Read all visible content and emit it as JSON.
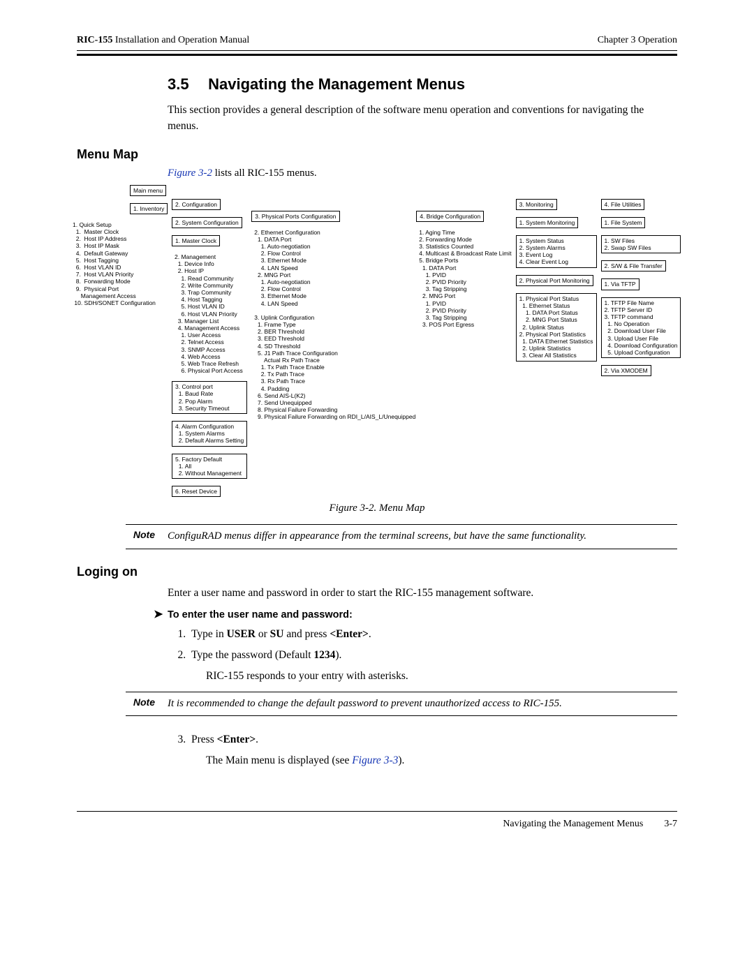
{
  "header": {
    "product": "RIC-155",
    "manual": "Installation and Operation Manual",
    "chapter": "Chapter 3  Operation"
  },
  "section": {
    "number": "3.5",
    "title": "Navigating the Management Menus",
    "intro": "This section provides a general description of the software menu operation and conventions for navigating the menus."
  },
  "menumap": {
    "heading": "Menu Map",
    "caption_ref": "Figure 3-2",
    "caption_rest": " lists all RIC-155 menus.",
    "figure_caption": "Figure 3-2.  Menu Map"
  },
  "tree": {
    "root": "Main menu",
    "inventory": {
      "label": "1. Inventory",
      "items": "1. Quick Setup\n  1.  Master Clock\n  2.  Host IP Address\n  3.  Host IP Mask\n  4.  Default Gateway\n  5.  Host Tagging\n  6.  Host VLAN ID\n  7.  Host VLAN Priority\n  8.  Forwarding Mode\n  9.  Physical Port\n     Management Access\n 10. SDH/SONET Configuration"
    },
    "configuration": {
      "label": "2. Configuration",
      "sysconf": "2. System Configuration",
      "masterclock": "1. Master Clock",
      "management": "2. Management\n  1. Device Info\n  2. Host IP\n    1. Read Community\n    2. Write Community\n    3. Trap Community\n    4. Host Tagging\n    5. Host VLAN ID\n    6. Host VLAN Priority\n  3. Manager List\n  4. Management Access\n    1. User Access\n    2. Telnet Access\n    3. SNMP Access\n    4. Web Access\n    5. Web Trace Refresh\n    6. Physical Port Access",
      "controlport": "3. Control port\n  1. Baud Rate\n  2. Pop Alarm\n  3. Security Timeout",
      "alarmconf": "4. Alarm Configuration\n  1. System Alarms\n  2. Default Alarms Setting",
      "factory": "5. Factory Default\n  1. All\n  2. Without Management",
      "reset": "6. Reset Device",
      "physports": "3. Physical Ports Configuration",
      "ethernet": "2. Ethernet Configuration\n  1. DATA Port\n    1. Auto-negotiation\n    2. Flow Control\n    3. Ethernet Mode\n    4. LAN Speed\n  2. MNG Port\n    1. Auto-negotiation\n    2. Flow Control\n    3. Ethernet Mode\n    4. LAN Speed",
      "uplink": "3. Uplink Configuration\n  1. Frame Type\n  2. BER Threshold\n  3. EED Threshold\n  4. SD Threshold\n  5. J1 Path Trace Configuration\n      Actual Rx Path Trace\n    1. Tx Path Trace Enable\n    2. Tx Path Trace\n    3. Rx Path Trace\n    4. Padding\n  6. Send AIS-L(K2)\n  7. Send Unequipped\n  8. Physical Failure Forwarding\n  9. Physical Failure Forwarding on RDI_L/AIS_L/Unequipped",
      "bridge": "4. Bridge Configuration",
      "bridgeitems": "1. Aging Time\n2. Forwarding Mode\n3. Statistics Counted\n4. Multicast & Broadcast Rate Limit\n5. Bridge Ports\n  1. DATA Port\n    1. PVID\n    2. PVID Priority\n    3. Tag Stripping\n  2. MNG Port\n    1. PVID\n    2. PVID Priority\n    3. Tag Stripping\n  3. POS Port Egress"
    },
    "monitoring": {
      "label": "3. Monitoring",
      "sysmon": "1. System Monitoring",
      "sysmonitems": "1. System Status\n2. System Alarms\n3. Event Log\n4. Clear Event Log",
      "ppmon": "2. Physical Port Monitoring",
      "ppmonitems": "1. Physical Port Status\n  1. Ethernet Status\n    1. DATA Port Status\n    2. MNG Port Status\n  2. Uplink Status\n2. Physical Port Statistics\n  1. DATA Ethernet Statistics\n  2. Uplink Statistics\n  3. Clear All Statistics"
    },
    "fileutil": {
      "label": "4. File Utilities",
      "filesys": "1. File System",
      "filesysitems": "1. SW Files\n2. Swap SW Files",
      "swfile": "2. S/W & File Transfer",
      "viatftp": "1. Via TFTP",
      "viatftpitems": "1. TFTP File Name\n2. TFTP Server ID\n3. TFTP command\n  1. No Operation\n  2. Download User File\n  3. Upload User File\n  4. Download Configuration\n  5. Upload Configuration",
      "viaxmodem": "2. Via XMODEM"
    }
  },
  "note1": {
    "label": "Note",
    "text": "ConfiguRAD menus differ in appearance from the terminal screens, but have the same functionality."
  },
  "login": {
    "heading": "Loging on",
    "para": "Enter a user name and password in order to start the RIC-155 management software.",
    "proc_title": "To enter the user name and password:",
    "step1_a": "Type in ",
    "step1_b": "USER",
    "step1_c": " or ",
    "step1_d": "SU",
    "step1_e": " and press ",
    "step1_f": "<Enter>",
    "step1_g": ".",
    "step2_a": "Type the password (Default ",
    "step2_b": "1234",
    "step2_c": ").",
    "step2_sub": "RIC-155 responds to your entry with asterisks.",
    "step3_a": "Press ",
    "step3_b": "<Enter>",
    "step3_c": ".",
    "step3_sub_a": "The Main menu is displayed (see ",
    "step3_sub_ref": "Figure 3-3",
    "step3_sub_b": ")."
  },
  "note2": {
    "label": "Note",
    "text": "It is recommended to change the default password to prevent unauthorized access to RIC-155."
  },
  "footer": {
    "title": "Navigating the Management Menus",
    "page": "3-7"
  }
}
